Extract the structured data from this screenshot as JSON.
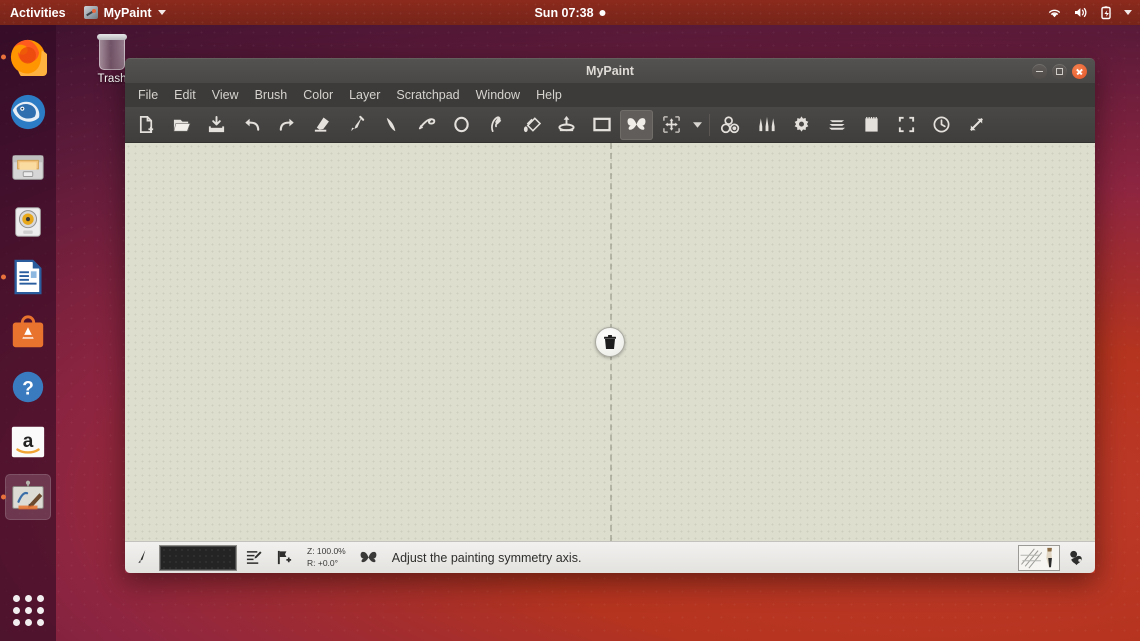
{
  "topbar": {
    "activities": "Activities",
    "app_name": "MyPaint",
    "app_icon": "mypaint-icon",
    "clock": "Sun 07:38",
    "indicators": [
      "wifi-icon",
      "volume-icon",
      "battery-icon",
      "caret-down-icon"
    ]
  },
  "dock": {
    "items": [
      {
        "name": "firefox",
        "label": "Firefox",
        "running": true
      },
      {
        "name": "thunderbird",
        "label": "Thunderbird",
        "running": false
      },
      {
        "name": "files",
        "label": "Files",
        "running": false
      },
      {
        "name": "rhythmbox",
        "label": "Rhythmbox",
        "running": false
      },
      {
        "name": "libreoffice-writer",
        "label": "LibreOffice Writer",
        "running": true
      },
      {
        "name": "ubuntu-software",
        "label": "Ubuntu Software",
        "running": false
      },
      {
        "name": "help",
        "label": "Help",
        "running": false
      },
      {
        "name": "amazon",
        "label": "Amazon",
        "running": false
      },
      {
        "name": "mypaint",
        "label": "MyPaint",
        "running": true,
        "active": true
      }
    ],
    "show_apps_label": "Show Applications"
  },
  "desktop": {
    "trash_label": "Trash"
  },
  "window": {
    "title": "MyPaint",
    "controls": {
      "minimize": "Minimize",
      "maximize": "Maximize",
      "close": "Close"
    },
    "menu": [
      "File",
      "Edit",
      "View",
      "Brush",
      "Color",
      "Layer",
      "Scratchpad",
      "Window",
      "Help"
    ],
    "toolbar": [
      {
        "name": "new-document-icon",
        "label": "New"
      },
      {
        "name": "open-document-icon",
        "label": "Open"
      },
      {
        "name": "save-document-icon",
        "label": "Save"
      },
      {
        "name": "undo-icon",
        "label": "Undo"
      },
      {
        "name": "redo-icon",
        "label": "Redo"
      },
      {
        "name": "eraser-icon",
        "label": "Eraser"
      },
      {
        "name": "paintbrush-icon",
        "label": "Paintbrush"
      },
      {
        "name": "line-tool-icon",
        "label": "Lines and Curves"
      },
      {
        "name": "freehand-icon",
        "label": "Connected Lines"
      },
      {
        "name": "ellipse-icon",
        "label": "Ellipse"
      },
      {
        "name": "inking-icon",
        "label": "Inking"
      },
      {
        "name": "flood-fill-icon",
        "label": "Flood Fill"
      },
      {
        "name": "move-layer-icon",
        "label": "Layer in Motion"
      },
      {
        "name": "frame-icon",
        "label": "Edit Frame"
      },
      {
        "name": "symmetry-icon",
        "label": "Symmetry",
        "active": true
      },
      {
        "name": "transform-icon",
        "label": "Transform"
      },
      {
        "name": "caret-down-icon",
        "label": "More tools"
      },
      {
        "name": "color-selector-icon",
        "label": "Color Selector"
      },
      {
        "name": "brush-selector-icon",
        "label": "Brush Selector"
      },
      {
        "name": "brush-settings-icon",
        "label": "Brush Settings"
      },
      {
        "name": "layers-icon",
        "label": "Layers"
      },
      {
        "name": "scratchpad-icon",
        "label": "Scratchpad"
      },
      {
        "name": "fullscreen-icon",
        "label": "Fullscreen"
      },
      {
        "name": "history-icon",
        "label": "History"
      },
      {
        "name": "expand-icon",
        "label": "Expand"
      }
    ],
    "canvas": {
      "symmetry_handle": "delete-symmetry-axis-icon"
    },
    "statusbar": {
      "brush_icon": "brush-icon",
      "color_value": "#242424",
      "edit_icon": "edit-brush-icon",
      "flag_icon": "add-marker-icon",
      "zoom_label": "Z: 100.0%",
      "rotation_label": "R: +0.0°",
      "status_icon": "symmetry-icon",
      "status_message": "Adjust the painting symmetry axis.",
      "brush_preview": "brush-preview-icon",
      "color_picker": "color-picker-icon"
    }
  }
}
